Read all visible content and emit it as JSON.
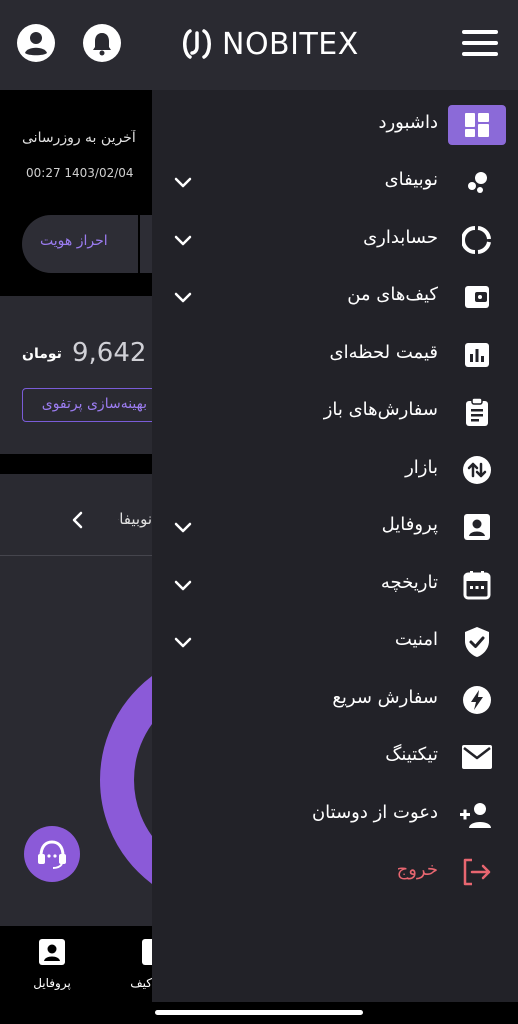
{
  "header": {
    "logo_text": "NOBITEX",
    "profile_icon": "account-circle-icon",
    "bell_icon": "bell-icon",
    "menu_icon": "hamburger-menu-icon"
  },
  "background": {
    "last_update_label": "آخرین به روزرسانی",
    "last_update_time": "00:27 1403/02/04",
    "kyc_button": "احراز هویت",
    "balance_value": "9,642",
    "balance_unit": "تومان",
    "portfolio_button": "بهینه‌سازی پرتفوی",
    "nobifi_link": "نوبیفای",
    "bottom_nav": {
      "profile_label": "پروفایل",
      "wallet_label": "کیف پول"
    }
  },
  "drawer": {
    "items": [
      {
        "label": "داشبورد",
        "icon": "dashboard-icon",
        "has_submenu": false,
        "active": true
      },
      {
        "label": "نوبیفای",
        "icon": "bubbles-icon",
        "has_submenu": true
      },
      {
        "label": "حسابداری",
        "icon": "donut-icon",
        "has_submenu": true
      },
      {
        "label": "کیف‌های من",
        "icon": "wallet-icon",
        "has_submenu": true
      },
      {
        "label": "قیمت لحظه‌ای",
        "icon": "bar-chart-icon",
        "has_submenu": false
      },
      {
        "label": "سفارش‌های باز",
        "icon": "clipboard-icon",
        "has_submenu": false
      },
      {
        "label": "بازار",
        "icon": "swap-vertical-icon",
        "has_submenu": false
      },
      {
        "label": "پروفایل",
        "icon": "profile-card-icon",
        "has_submenu": true
      },
      {
        "label": "تاریخچه",
        "icon": "calendar-icon",
        "has_submenu": true
      },
      {
        "label": "امنیت",
        "icon": "shield-check-icon",
        "has_submenu": true
      },
      {
        "label": "سفارش سریع",
        "icon": "lightning-icon",
        "has_submenu": false
      },
      {
        "label": "تیکتینگ",
        "icon": "envelope-icon",
        "has_submenu": false
      },
      {
        "label": "دعوت از دوستان",
        "icon": "add-user-icon",
        "has_submenu": false
      },
      {
        "label": "خروج",
        "icon": "logout-icon",
        "has_submenu": false
      }
    ]
  },
  "colors": {
    "accent": "#8b6ad8",
    "logout": "#e86670",
    "drawer_bg": "#222228",
    "header_bg": "#2a2a31"
  }
}
